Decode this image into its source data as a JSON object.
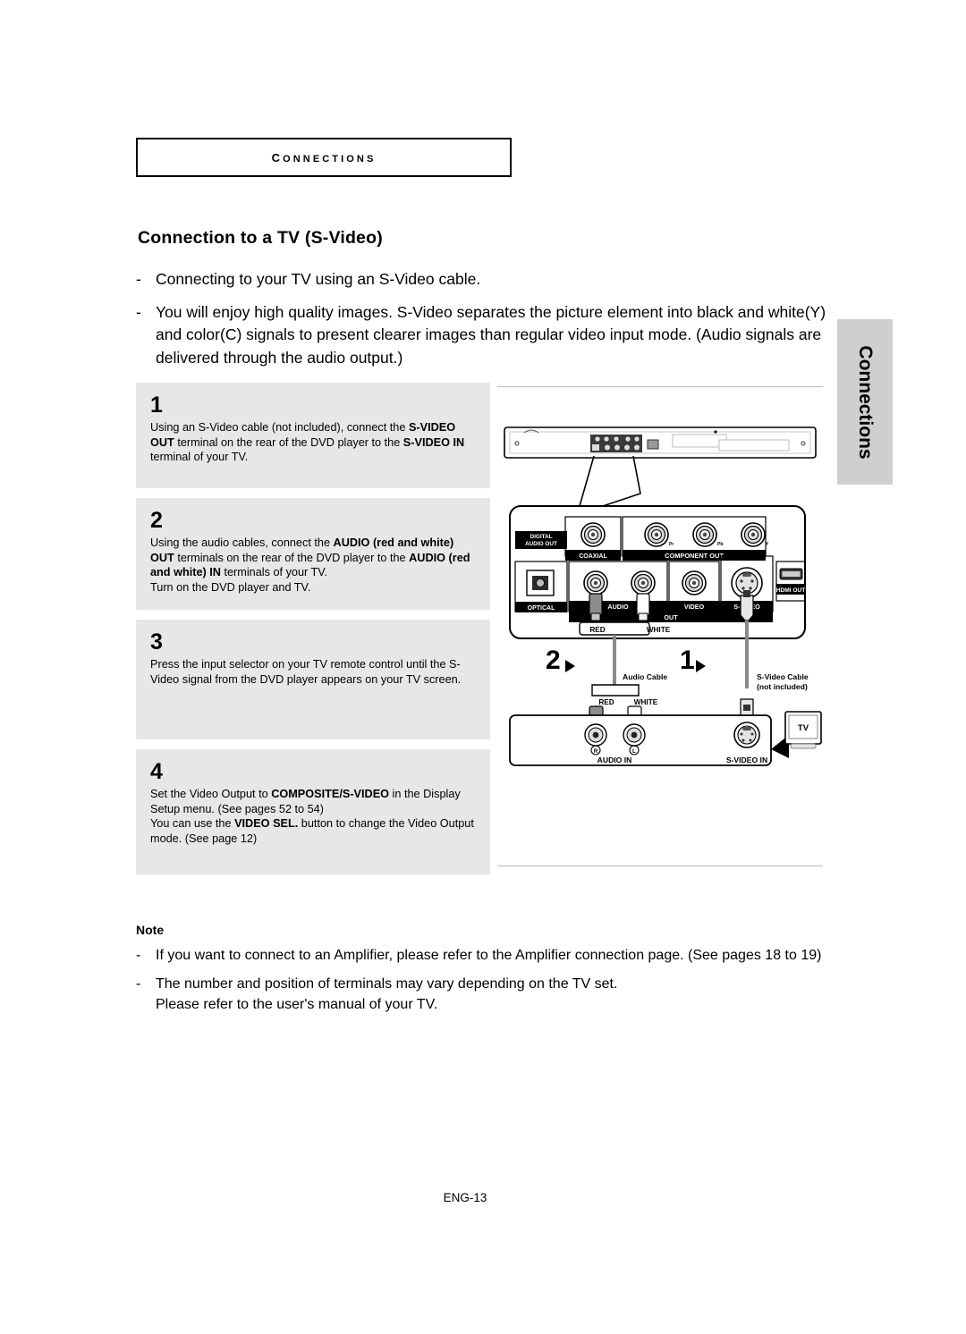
{
  "section_header": {
    "label": "Connections"
  },
  "page_title": "Connection to a TV (S-Video)",
  "intro": {
    "dash": "-",
    "bullets": [
      "Connecting to your TV using an S-Video cable.",
      "You will enjoy high quality images. S-Video separates the picture element into black and white(Y) and color(C) signals to present clearer images than regular video input mode. (Audio signals are delivered through the audio output.)"
    ]
  },
  "steps": [
    {
      "number": "1",
      "parts": [
        {
          "text": "Using an S-Video cable (not included), connect the ",
          "bold": false
        },
        {
          "text": "S-VIDEO OUT",
          "bold": true
        },
        {
          "text": " terminal on the rear of the DVD player to the ",
          "bold": false
        },
        {
          "text": "S-VIDEO IN",
          "bold": true
        },
        {
          "text": " terminal of your TV.",
          "bold": false
        }
      ]
    },
    {
      "number": "2",
      "parts": [
        {
          "text": "Using the audio cables, connect the ",
          "bold": false
        },
        {
          "text": "AUDIO (red and white) OUT",
          "bold": true
        },
        {
          "text": " terminals on the rear of the DVD player to the ",
          "bold": false
        },
        {
          "text": "AUDIO (red and white) IN",
          "bold": true
        },
        {
          "text": " terminals of your TV.",
          "bold": false
        },
        {
          "text": "Turn on the DVD player and TV.",
          "bold": false,
          "newline": true
        }
      ]
    },
    {
      "number": "3",
      "parts": [
        {
          "text": "Press the input selector on your TV remote control until the S-Video signal from the DVD player appears on your TV screen.",
          "bold": false
        }
      ]
    },
    {
      "number": "4",
      "parts": [
        {
          "text": "Set the Video Output to ",
          "bold": false
        },
        {
          "text": "COMPOSITE/S-VIDEO",
          "bold": true
        },
        {
          "text": " in the Display Setup menu. (See pages 52 to 54)",
          "bold": false
        },
        {
          "text": "You can use the ",
          "bold": false,
          "newline": true
        },
        {
          "text": "VIDEO SEL.",
          "bold": true
        },
        {
          "text": " button to change the Video Output mode. (See page 12)",
          "bold": false
        }
      ]
    }
  ],
  "side_tab": {
    "label": "Connections"
  },
  "note": {
    "title": "Note",
    "dash": "-",
    "bullets": [
      "If you want to connect to an Amplifier, please refer to the Amplifier connection page. (See pages 18 to 19)",
      "The number and position of terminals may vary depending on the TV set.\nPlease refer to the user's manual of your TV."
    ]
  },
  "footer": {
    "page_label": "ENG-13"
  },
  "diagram": {
    "rear_panel": {
      "digital_audio_out": "DIGITAL\nAUDIO OUT",
      "coaxial": "COAXIAL",
      "optical": "OPTICAL",
      "component_out": "COMPONENT OUT",
      "component_jacks": [
        "Pr",
        "Pb",
        "Y"
      ],
      "audio": "AUDIO",
      "video": "VIDEO",
      "s_video": "S-VIDEO",
      "out": "OUT",
      "hdmi_out": "HDMI OUT"
    },
    "cables": {
      "out_red": "RED",
      "out_white": "WHITE",
      "in_red": "RED",
      "in_white": "WHITE",
      "step2_marker": "2",
      "step1_marker": "1",
      "audio_cable": "Audio Cable",
      "svideo_cable": "S-Video Cable",
      "svideo_cable_note": "(not included)"
    },
    "tv": {
      "audio_in": "AUDIO IN",
      "s_video_in": "S-VIDEO IN",
      "jack_r": "R",
      "jack_l": "L",
      "tv_label": "TV"
    }
  }
}
